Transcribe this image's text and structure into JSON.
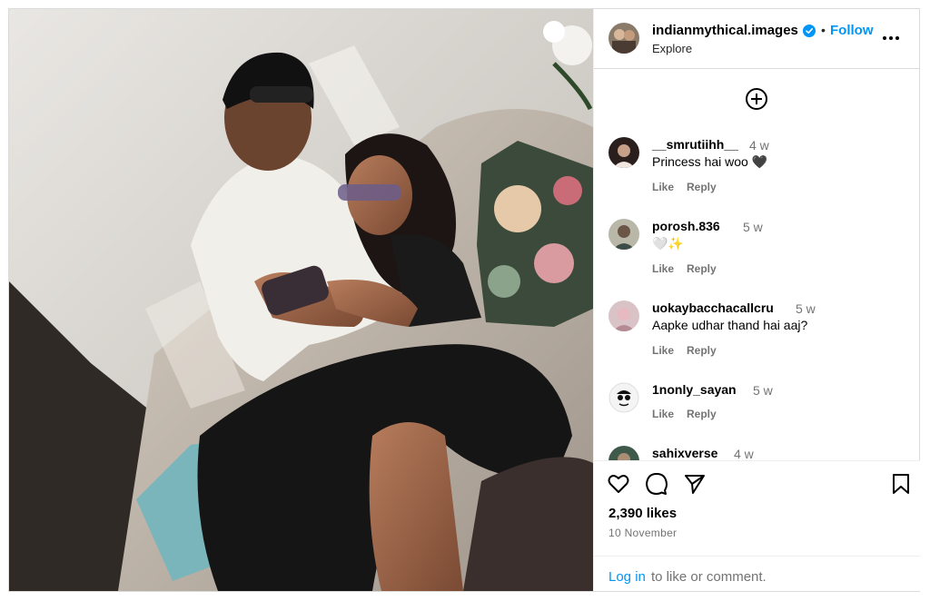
{
  "post": {
    "image_alt": "Photo of two people sitting on a couch looking at a phone",
    "author": {
      "username": "indianmythical.images",
      "verified": true,
      "separator": "•",
      "follow_label": "Follow",
      "subline": "Explore"
    },
    "more_icon": "more-horizontal-icon",
    "add_comment_icon": "plus-circle-icon",
    "comments": [
      {
        "username": "__smrutiihh__",
        "time": "4 w",
        "text": "Princess hai woo 🖤",
        "like_label": "Like",
        "reply_label": "Reply"
      },
      {
        "username": "porosh.836",
        "time": "5 w",
        "text": "🤍✨",
        "like_label": "Like",
        "reply_label": "Reply"
      },
      {
        "username": "uokaybacchacallcru",
        "time": "5 w",
        "text": "Aapke udhar thand hai aaj?",
        "like_label": "Like",
        "reply_label": "Reply"
      },
      {
        "username": "1nonly_sayan",
        "time": "5 w",
        "text": "",
        "like_label": "Like",
        "reply_label": "Reply"
      },
      {
        "username": "sahixverse",
        "time": "4 w",
        "text": "",
        "like_label": "",
        "reply_label": ""
      }
    ],
    "actions": {
      "icons": [
        "heart-icon",
        "comment-icon",
        "share-icon",
        "bookmark-icon"
      ]
    },
    "likes": "2,390 likes",
    "date": "10 November",
    "login": {
      "link_label": "Log in",
      "rest_text": "to like or comment."
    }
  },
  "colors": {
    "link_blue": "#0095f6",
    "secondary_text": "#737373",
    "border": "#dbdbdb"
  }
}
